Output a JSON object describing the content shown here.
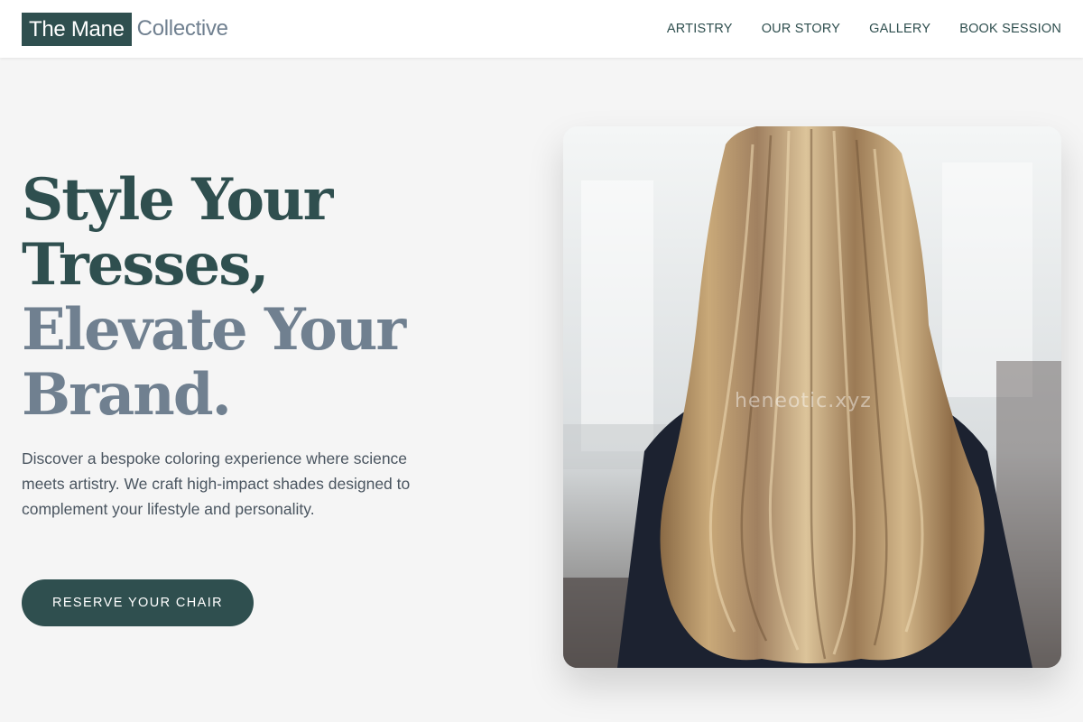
{
  "brand": {
    "name_primary": "The Mane",
    "name_secondary": "Collective"
  },
  "nav": {
    "items": [
      "ARTISTRY",
      "OUR STORY",
      "GALLERY",
      "BOOK SESSION"
    ]
  },
  "hero": {
    "headline_lines": [
      "Style Your",
      "Tresses,",
      "Elevate Your",
      "Brand."
    ],
    "description": "Discover a bespoke coloring experience where science meets artistry. We craft high-impact shades designed to complement your lifestyle and personality.",
    "cta_label": "RESERVE YOUR CHAIR",
    "image_watermark": "heneotic.xyz",
    "image_subject": "long blonde balayage wavy hair viewed from behind in a salon"
  },
  "colors": {
    "primary": "#2f4f4f",
    "secondary": "#708090",
    "background": "#f5f5f5",
    "header_bg": "#ffffff",
    "body_text": "#4a5560"
  }
}
